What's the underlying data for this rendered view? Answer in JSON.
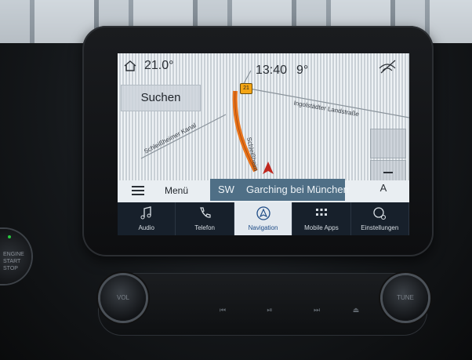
{
  "status": {
    "temp_outside": "21.0°",
    "clock": "13:40",
    "temp_cabin": "9°"
  },
  "map": {
    "search_label": "Suchen",
    "route_shield": "21",
    "street_labels": [
      "Ingolstädter Landstraße",
      "Schleißheimer Kanal",
      "Schleißheim"
    ]
  },
  "bottom_bar": {
    "menu_label": "Menü",
    "heading": "SW",
    "destination": "Garching bei München",
    "compass": "A"
  },
  "tabs": [
    {
      "label": "Audio",
      "icon": "music-note-icon"
    },
    {
      "label": "Telefon",
      "icon": "phone-icon"
    },
    {
      "label": "Navigation",
      "icon": "navigation-icon",
      "active": true
    },
    {
      "label": "Mobile Apps",
      "icon": "apps-grid-icon"
    },
    {
      "label": "Einstellungen",
      "icon": "settings-gear-icon"
    }
  ],
  "console": {
    "vol_label": "VOL",
    "tune_label": "TUNE",
    "start_label": "ENGINE START STOP"
  },
  "colors": {
    "tab_bar": "#17202b",
    "active_tab": "#e2e8ee",
    "active_text": "#1d4b86",
    "route": "#e8731a",
    "destination_bar": "#4f6f86"
  }
}
